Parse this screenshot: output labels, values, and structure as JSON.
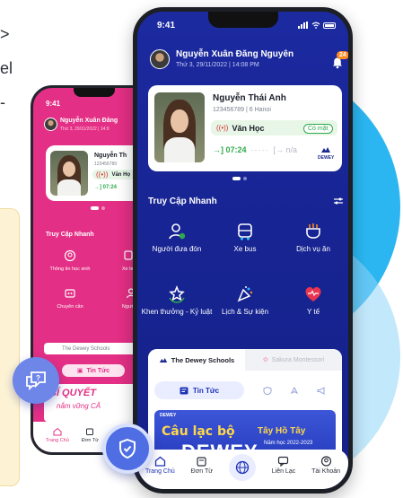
{
  "colors": {
    "brand_blue": "#1a2a8f",
    "brand_pink": "#e32f85",
    "present_green": "#2eaa4a",
    "accent_orange": "#ff8a1f",
    "cyan_blob": "#2bb6f2"
  },
  "bg_text": {
    "line1": ">",
    "line2": "el",
    "line3": "-"
  },
  "front": {
    "status_time": "9:41",
    "user_name": "Nguyễn Xuân Đăng Nguyên",
    "date": "Thứ 3, 29/11/2022 | 14:08 PM",
    "notification_count": "24",
    "student": {
      "name": "Nguyễn Thái Anh",
      "sub": "123456789 | 6 Hanoi",
      "class_name": "Văn Học",
      "attendance": "Có mặt",
      "time_in": "07:24",
      "time_out": "n/a",
      "school_logo": "DEWEY"
    },
    "quick_access": {
      "title": "Truy Cập Nhanh",
      "items": [
        {
          "label": "Người đưa đón",
          "icon": "pickup-person-icon"
        },
        {
          "label": "Xe bus",
          "icon": "bus-icon"
        },
        {
          "label": "Dịch vụ ăn",
          "icon": "meal-service-icon"
        },
        {
          "label": "Khen thưởng - Kỷ luật",
          "icon": "award-icon"
        },
        {
          "label": "Lịch & Sự kiện",
          "icon": "calendar-events-icon"
        },
        {
          "label": "Y tế",
          "icon": "medical-heart-icon"
        }
      ]
    },
    "schools": {
      "tab_active": "The Dewey Schools",
      "tab_inactive": "Sakura Montessori",
      "news_label": "Tin Tức"
    },
    "banner": {
      "top_text": "DEWEY",
      "title": "Câu lạc bộ",
      "subtitle": "Tây Hồ Tây",
      "brand": "DEWEY",
      "year": "Năm học 2022-2023"
    },
    "nav": {
      "home": "Trang Chủ",
      "school": "Đơn Từ",
      "contact": "Liên Lạc",
      "account": "Tài Khoản"
    }
  },
  "back": {
    "status_time": "9:41",
    "user_name": "Nguyễn Xuân Đăng",
    "date": "Thứ 3, 29/11/2022 | 14:0",
    "student_name": "Nguyễn Th",
    "student_sub": "123456789",
    "class_name": "Văn Họ",
    "time_in": "07:24",
    "quick_access_title": "Truy Cập Nhanh",
    "qa_items": [
      {
        "label": "Thông tin học sinh"
      },
      {
        "label": "Xe bu"
      },
      {
        "label": "Chuyên cần"
      },
      {
        "label": "Người đ"
      }
    ],
    "schools_tab": "The Dewey Schools",
    "news_label": "Tin Tức",
    "banner_line1": "BÍ QUYẾT",
    "banner_line2": "nắm vững CĂ",
    "nav": {
      "home": "Trang Chủ",
      "school": "Đơn Từ"
    }
  }
}
